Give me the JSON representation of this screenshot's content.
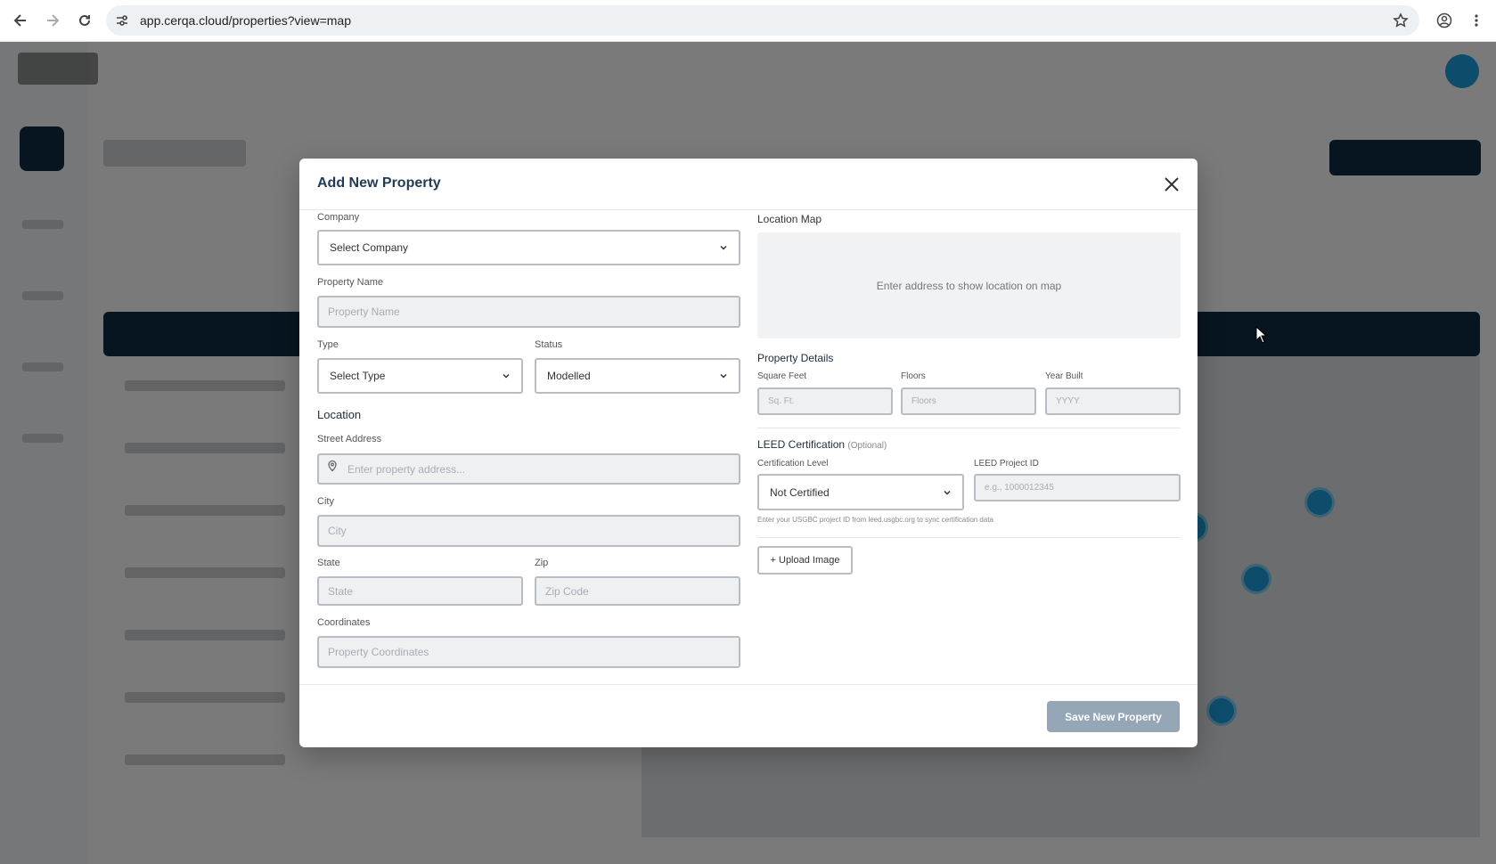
{
  "browser": {
    "url": "app.cerqa.cloud/properties?view=map"
  },
  "modal": {
    "title": "Add New Property",
    "company": {
      "label": "Company",
      "value": "Select Company"
    },
    "property_name": {
      "label": "Property Name",
      "placeholder": "Property Name"
    },
    "type": {
      "label": "Type",
      "value": "Select Type"
    },
    "status": {
      "label": "Status",
      "value": "Modelled"
    },
    "location": {
      "title": "Location",
      "street": {
        "label": "Street Address",
        "placeholder": "Enter property address..."
      },
      "city": {
        "label": "City",
        "placeholder": "City"
      },
      "state": {
        "label": "State",
        "placeholder": "State"
      },
      "zip": {
        "label": "Zip",
        "placeholder": "Zip Code"
      },
      "coordinates": {
        "label": "Coordinates",
        "placeholder": "Property Coordinates"
      }
    },
    "location_map": {
      "title": "Location Map",
      "message": "Enter address to show location on map"
    },
    "property_details": {
      "title": "Property Details",
      "square_feet": {
        "label": "Square Feet",
        "placeholder": "Sq. Ft."
      },
      "floors": {
        "label": "Floors",
        "placeholder": "Floors"
      },
      "year_built": {
        "label": "Year Built",
        "placeholder": "YYYY"
      }
    },
    "leed": {
      "title": "LEED Certification",
      "optional": "(Optional)",
      "level": {
        "label": "Certification Level",
        "value": "Not Certified"
      },
      "project_id": {
        "label": "LEED Project ID",
        "placeholder": "e.g., 1000012345"
      },
      "hint": "Enter your USGBC project ID from leed.usgbc.org to sync certification data"
    },
    "upload_label": "+ Upload Image",
    "save_label": "Save New Property"
  }
}
